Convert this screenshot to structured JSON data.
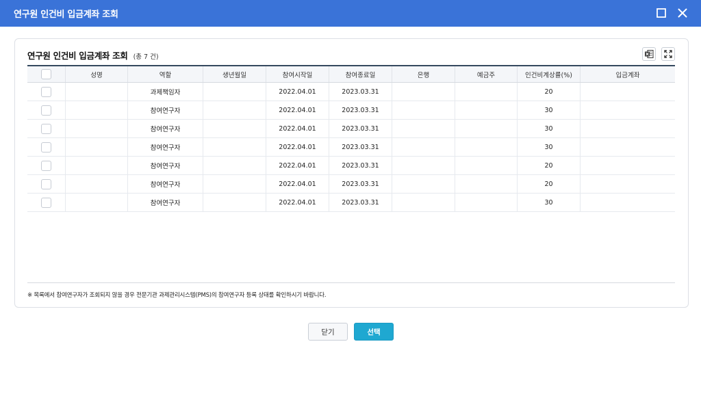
{
  "window": {
    "title": "연구원 인건비 입금계좌 조회"
  },
  "panel": {
    "title": "연구원 인건비 입금계좌 조회",
    "count_text": "(총 7 건)",
    "excel_icon": "excel-download-icon",
    "expand_icon": "fullscreen-expand-icon"
  },
  "grid": {
    "columns": [
      "",
      "성명",
      "역할",
      "생년월일",
      "참여시작일",
      "참여종료일",
      "은행",
      "예금주",
      "인건비계상률(%)",
      "입금계좌"
    ],
    "rows": [
      {
        "name": "",
        "role": "과제책임자",
        "birth": "",
        "start": "2022.04.01",
        "end": "2023.03.31",
        "bank": "",
        "holder": "",
        "rate": "20",
        "account": ""
      },
      {
        "name": "",
        "role": "참여연구자",
        "birth": "",
        "start": "2022.04.01",
        "end": "2023.03.31",
        "bank": "",
        "holder": "",
        "rate": "30",
        "account": ""
      },
      {
        "name": "",
        "role": "참여연구자",
        "birth": "",
        "start": "2022.04.01",
        "end": "2023.03.31",
        "bank": "",
        "holder": "",
        "rate": "30",
        "account": ""
      },
      {
        "name": "",
        "role": "참여연구자",
        "birth": "",
        "start": "2022.04.01",
        "end": "2023.03.31",
        "bank": "",
        "holder": "",
        "rate": "30",
        "account": ""
      },
      {
        "name": "",
        "role": "참여연구자",
        "birth": "",
        "start": "2022.04.01",
        "end": "2023.03.31",
        "bank": "",
        "holder": "",
        "rate": "20",
        "account": ""
      },
      {
        "name": "",
        "role": "참여연구자",
        "birth": "",
        "start": "2022.04.01",
        "end": "2023.03.31",
        "bank": "",
        "holder": "",
        "rate": "20",
        "account": ""
      },
      {
        "name": "",
        "role": "참여연구자",
        "birth": "",
        "start": "2022.04.01",
        "end": "2023.03.31",
        "bank": "",
        "holder": "",
        "rate": "30",
        "account": ""
      }
    ]
  },
  "note": "※ 목록에서 참여연구자가 조회되지 않을 경우 전문기관 과제관리시스템(PMS)의 참여연구자 등록 상태를 확인하시기 바랍니다.",
  "buttons": {
    "close": "닫기",
    "select": "선택"
  },
  "colors": {
    "titlebar": "#3a73d8",
    "select_button": "#1fa8d1"
  }
}
